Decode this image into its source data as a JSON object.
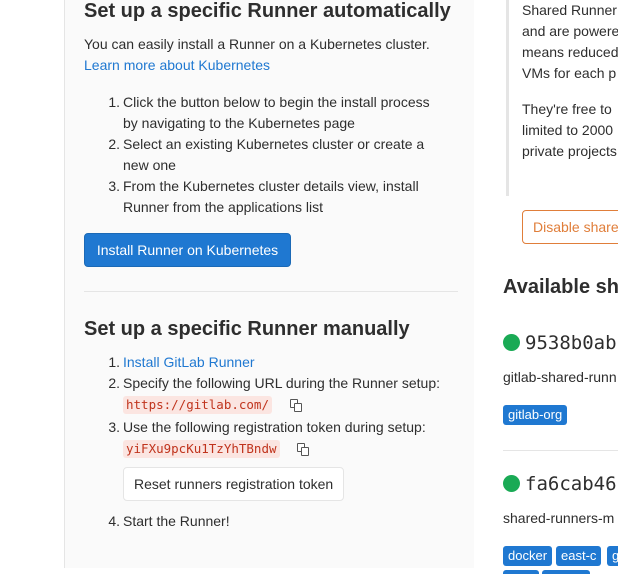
{
  "auto": {
    "title": "Set up a specific Runner automatically",
    "intro": "You can easily install a Runner on a Kubernetes cluster.",
    "learn_more": "Learn more about Kubernetes",
    "steps": [
      {
        "num": "1.",
        "lines": [
          "Click the button below to begin the install process",
          "by navigating to the Kubernetes page"
        ]
      },
      {
        "num": "2.",
        "lines": [
          "Select an existing Kubernetes cluster or create a",
          "new one"
        ]
      },
      {
        "num": "3.",
        "lines": [
          "From the Kubernetes cluster details view, install",
          "Runner from the applications list"
        ]
      }
    ],
    "install_button": "Install Runner on Kubernetes"
  },
  "manual": {
    "title": "Set up a specific Runner manually",
    "step1_num": "1.",
    "step1_link": "Install GitLab Runner",
    "step2_num": "2.",
    "step2_text": "Specify the following URL during the Runner setup:",
    "url": "https://gitlab.com/",
    "step3_num": "3.",
    "step3_text": "Use the following registration token during setup:",
    "token": "yiFXu9pcKu1TzYhTBndw",
    "reset_button": "Reset runners registration token",
    "step4_num": "4.",
    "step4_text": "Start the Runner!"
  },
  "shared": {
    "link": "Shared Runner",
    "lines": [
      "and are powere",
      "means reduced",
      "VMs for each p"
    ],
    "lines2": [
      "They're free to",
      "limited to 2000",
      "private projects"
    ],
    "disable_button": "Disable share",
    "available_title": "Available sh",
    "runners": [
      {
        "id": "9538b0ab",
        "desc": "gitlab-shared-runn",
        "tags": [
          "gitlab-org"
        ]
      },
      {
        "id": "fa6cab46",
        "desc": "shared-runners-m",
        "tags": [
          "docker",
          "east-c",
          "g"
        ]
      }
    ],
    "status_color": "#1aaa55",
    "tag_color": "#1f78d1"
  }
}
